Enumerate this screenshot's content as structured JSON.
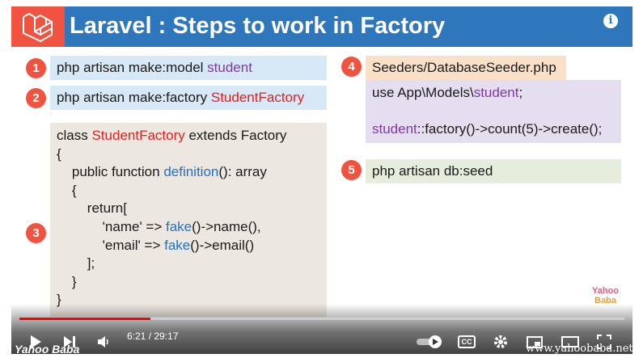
{
  "header": {
    "title": "Laravel : Steps to work in Factory",
    "info_glyph": "i"
  },
  "steps": {
    "s1": "1",
    "s2": "2",
    "s3": "3",
    "s4": "4",
    "s5": "5"
  },
  "cmd1": {
    "prefix": "php artisan make:model ",
    "model": "student"
  },
  "cmd2": {
    "prefix": "php artisan make:factory ",
    "factory": "StudentFactory"
  },
  "code": {
    "l1a": "class ",
    "l1b": "StudentFactory",
    "l1c": " extends Factory",
    "l2": "{",
    "l3a": "    public function ",
    "l3b": "definition",
    "l3c": "(): array",
    "l4": "    {",
    "l5": "        return[",
    "l6a": "            'name' => ",
    "l6b": "fake",
    "l6c": "()->name(),",
    "l7a": "            'email' => ",
    "l7b": "fake",
    "l7c": "()->email()",
    "l8": "        ];",
    "l9": "    }",
    "l10": "}"
  },
  "seeder": {
    "file": "Seeders/DatabaseSeeder.php",
    "use_a": "use App\\Models\\",
    "use_b": "student",
    "use_c": ";",
    "call_a": "student",
    "call_b": "::factory()->count(5)->create();"
  },
  "seed_cmd": "php artisan db:seed",
  "watermark": {
    "line1": "Yahoo",
    "line2": "Baba",
    "color1": "#e05a7a",
    "color2": "#e0a040"
  },
  "player": {
    "time": "6:21 / 29:17",
    "progress": 0.216,
    "channel_watermark": "Yahoo Baba",
    "site_watermark": "www.yahoobaba.net",
    "cc_label": "CC"
  },
  "colors": {
    "header": "#2e77bd",
    "accent": "#f05340",
    "progress": "#ff0000"
  }
}
